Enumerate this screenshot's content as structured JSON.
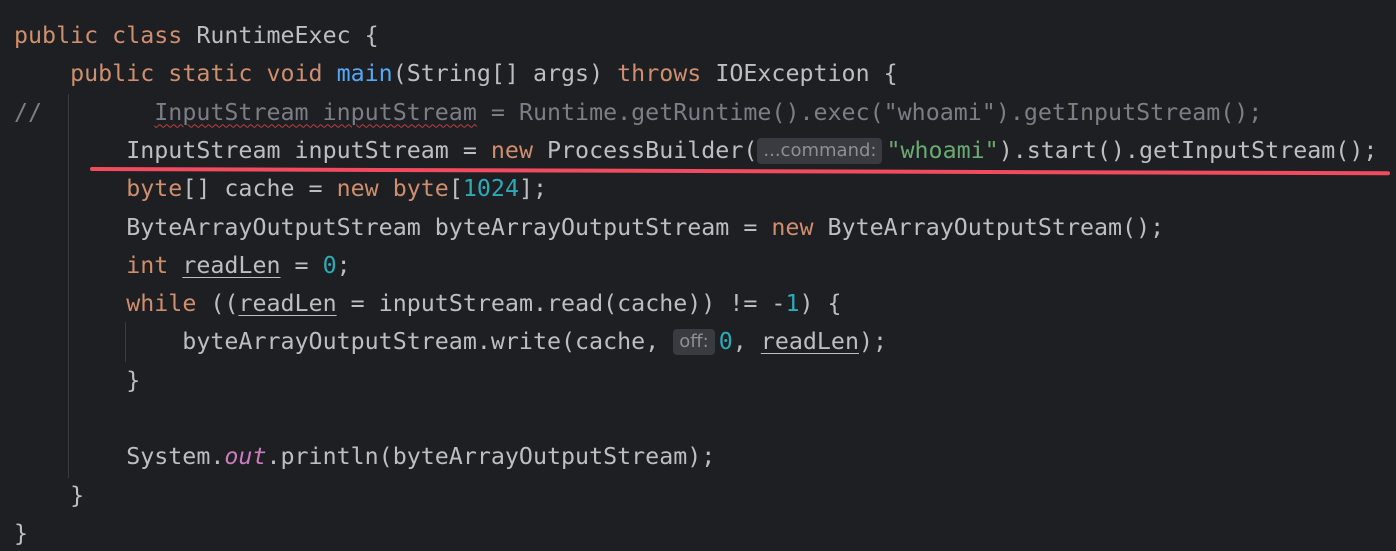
{
  "editor": {
    "language": "java",
    "lines": [
      {
        "tokens": [
          {
            "cls": "kw",
            "text": "public class "
          },
          {
            "cls": "",
            "text": "RuntimeExec {"
          }
        ]
      },
      {
        "tokens": [
          {
            "cls": "",
            "text": "    "
          },
          {
            "cls": "kw",
            "text": "public static void "
          },
          {
            "cls": "fn",
            "text": "main"
          },
          {
            "cls": "",
            "text": "(String[] args) "
          },
          {
            "cls": "kw",
            "text": "throws "
          },
          {
            "cls": "",
            "text": "IOException {"
          }
        ]
      },
      {
        "tokens": [
          {
            "cls": "comment",
            "text": "//        "
          },
          {
            "cls": "comment squiggle",
            "text": "InputStream inputStream"
          },
          {
            "cls": "comment",
            "text": " = Runtime.getRuntime().exec(\"whoami\").getInputStream();"
          }
        ]
      },
      {
        "tokens": [
          {
            "cls": "",
            "text": "        InputStream inputStream = "
          },
          {
            "cls": "kw",
            "text": "new "
          },
          {
            "cls": "",
            "text": "ProcessBuilder("
          },
          {
            "cls": "hint",
            "text": "...command:"
          },
          {
            "cls": "str",
            "text": "\"whoami\""
          },
          {
            "cls": "",
            "text": ").start().getInputStream();"
          }
        ]
      },
      {
        "tokens": [
          {
            "cls": "",
            "text": "        "
          },
          {
            "cls": "kw",
            "text": "byte"
          },
          {
            "cls": "",
            "text": "[] cache = "
          },
          {
            "cls": "kw",
            "text": "new byte"
          },
          {
            "cls": "",
            "text": "["
          },
          {
            "cls": "num",
            "text": "1024"
          },
          {
            "cls": "",
            "text": "];"
          }
        ]
      },
      {
        "tokens": [
          {
            "cls": "",
            "text": "        ByteArrayOutputStream byteArrayOutputStream = "
          },
          {
            "cls": "kw",
            "text": "new "
          },
          {
            "cls": "",
            "text": "ByteArrayOutputStream();"
          }
        ]
      },
      {
        "tokens": [
          {
            "cls": "",
            "text": "        "
          },
          {
            "cls": "kw",
            "text": "int "
          },
          {
            "cls": "uline",
            "text": "readLen"
          },
          {
            "cls": "",
            "text": " = "
          },
          {
            "cls": "num",
            "text": "0"
          },
          {
            "cls": "",
            "text": ";"
          }
        ]
      },
      {
        "tokens": [
          {
            "cls": "",
            "text": "        "
          },
          {
            "cls": "kw",
            "text": "while "
          },
          {
            "cls": "",
            "text": "(("
          },
          {
            "cls": "uline",
            "text": "readLen"
          },
          {
            "cls": "",
            "text": " = inputStream.read(cache)) != -"
          },
          {
            "cls": "num",
            "text": "1"
          },
          {
            "cls": "",
            "text": ") {"
          }
        ]
      },
      {
        "tokens": [
          {
            "cls": "",
            "text": "            byteArrayOutputStream.write(cache, "
          },
          {
            "cls": "hint",
            "text": "off:"
          },
          {
            "cls": "num",
            "text": "0"
          },
          {
            "cls": "",
            "text": ", "
          },
          {
            "cls": "uline",
            "text": "readLen"
          },
          {
            "cls": "",
            "text": ");"
          }
        ]
      },
      {
        "tokens": [
          {
            "cls": "",
            "text": "        }"
          }
        ]
      },
      {
        "tokens": []
      },
      {
        "tokens": [
          {
            "cls": "",
            "text": "        System."
          },
          {
            "cls": "field",
            "text": "out"
          },
          {
            "cls": "",
            "text": ".println(byteArrayOutputStream);"
          }
        ]
      },
      {
        "tokens": [
          {
            "cls": "",
            "text": "    }"
          }
        ]
      },
      {
        "tokens": [
          {
            "cls": "",
            "text": "}"
          }
        ]
      }
    ]
  },
  "colors": {
    "background": "#1e1f22",
    "keyword": "#cf8e6d",
    "function": "#56a8f5",
    "string": "#6aab73",
    "number": "#2aacb8",
    "comment": "#7a7e85",
    "annotation_underline": "#f24b5f"
  }
}
